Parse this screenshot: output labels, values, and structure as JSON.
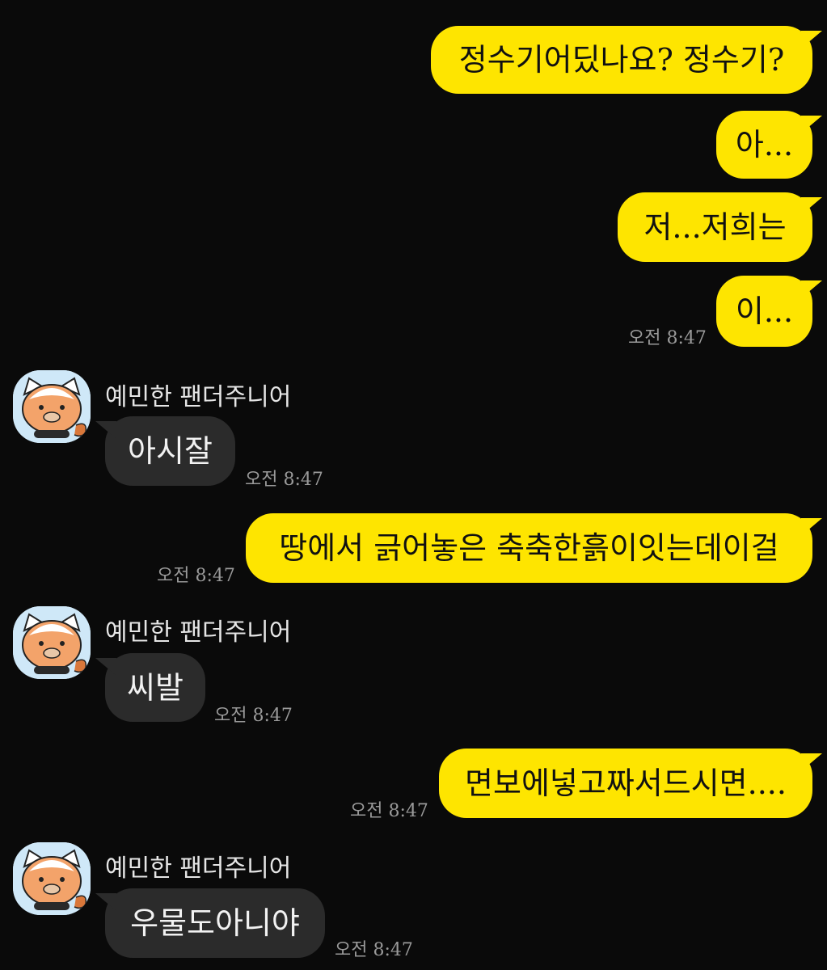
{
  "chat": {
    "sender_name": "예민한 팬더주니어",
    "messages": [
      {
        "from": "me",
        "text": "정수기어딨나요? 정수기?"
      },
      {
        "from": "me",
        "text": "아..."
      },
      {
        "from": "me",
        "text": "저...저희는"
      },
      {
        "from": "me",
        "text": "이...",
        "time": "오전 8:47"
      },
      {
        "from": "them",
        "text": "아시잘",
        "time": "오전 8:47"
      },
      {
        "from": "me",
        "text": "땅에서 긁어놓은 축축한흙이잇는데이걸",
        "time": "오전 8:47"
      },
      {
        "from": "them",
        "text": "씨발",
        "time": "오전 8:47"
      },
      {
        "from": "me",
        "text": "면보에넣고짜서드시면....",
        "time": "오전 8:47"
      },
      {
        "from": "them",
        "text": "우물도아니야",
        "time": "오전 8:47"
      }
    ]
  },
  "colors": {
    "background": "#0a0a0a",
    "my_bubble": "#fee500",
    "their_bubble": "#2b2b2b",
    "avatar_bg": "#cfe8f8"
  },
  "icons": {
    "avatar": "red-panda-avatar-icon"
  }
}
